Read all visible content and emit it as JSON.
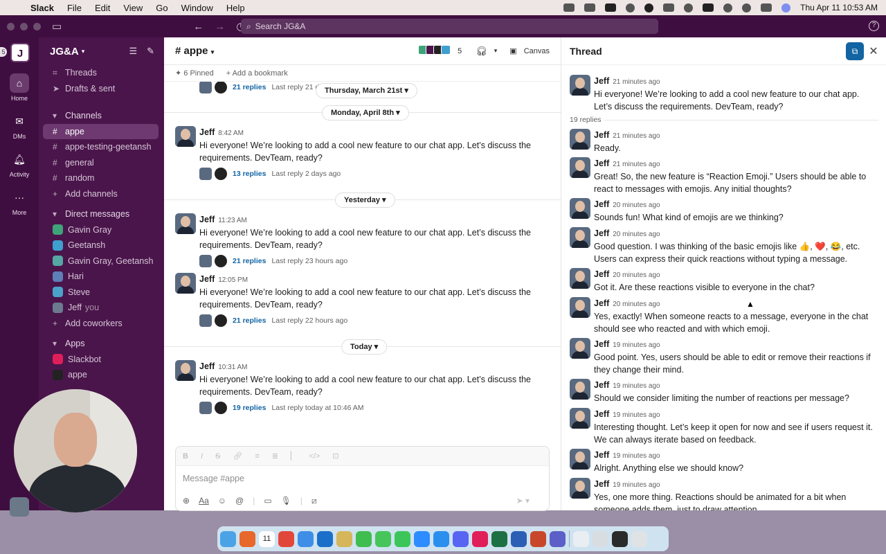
{
  "menubar": {
    "app": "Slack",
    "items": [
      "File",
      "Edit",
      "View",
      "Go",
      "Window",
      "Help"
    ],
    "datetime": "Thu Apr 11  10:53 AM"
  },
  "topbar": {
    "search_placeholder": "Search JG&A"
  },
  "rail": {
    "workspace_initial": "J",
    "badge": "5",
    "items": [
      {
        "label": "Home",
        "icon": "home-icon"
      },
      {
        "label": "DMs",
        "icon": "dm-icon"
      },
      {
        "label": "Activity",
        "icon": "bell-icon"
      },
      {
        "label": "More",
        "icon": "more-icon"
      }
    ]
  },
  "sidebar": {
    "workspace": "JG&A",
    "threads": "Threads",
    "drafts": "Drafts & sent",
    "channels_header": "Channels",
    "channels": [
      "appe",
      "appe-testing-geetansh",
      "general",
      "random"
    ],
    "add_channels": "Add channels",
    "dm_header": "Direct messages",
    "dms": [
      {
        "name": "Gavin Gray",
        "color": "#3fa37a"
      },
      {
        "name": "Geetansh",
        "color": "#3f9fcf"
      },
      {
        "name": "Gavin Gray, Geetansh",
        "color": "#56a6a3"
      },
      {
        "name": "Hari",
        "color": "#5e7fb8"
      },
      {
        "name": "Steve",
        "color": "#4aa3c8"
      },
      {
        "name": "Jeff",
        "color": "#6b7a8f"
      }
    ],
    "you": "you",
    "add_coworkers": "Add coworkers",
    "apps_header": "Apps",
    "apps": [
      "Slackbot",
      "appe"
    ]
  },
  "channel": {
    "name": "appe",
    "member_count": "5",
    "canvas": "Canvas",
    "pinned": "6 Pinned",
    "bookmark": "Add a bookmark",
    "dates": [
      "Thursday, March 21st",
      "Monday, April 8th",
      "Yesterday",
      "Today"
    ],
    "top_partial": {
      "replies": "21 replies",
      "last": "Last reply 21 da"
    },
    "messages": [
      {
        "name": "Jeff",
        "time": "8:42 AM",
        "text": "Hi everyone!  We’re looking to add a cool new feature to our chat app. Let’s discuss the requirements. DevTeam, ready?",
        "replies": "13 replies",
        "last": "Last reply 2 days ago"
      },
      {
        "name": "Jeff",
        "time": "11:23 AM",
        "text": "Hi everyone!  We’re looking to add a cool new feature to our chat app. Let’s discuss the requirements. DevTeam, ready?",
        "replies": "21 replies",
        "last": "Last reply 23 hours ago"
      },
      {
        "name": "Jeff",
        "time": "12:05 PM",
        "text": "Hi everyone!  We’re looking to add a cool new feature to our chat app. Let’s discuss the requirements. DevTeam, ready?",
        "replies": "21 replies",
        "last": "Last reply 22 hours ago"
      },
      {
        "name": "Jeff",
        "time": "10:31 AM",
        "text": "Hi everyone! We’re looking to add a cool new feature to our chat app. Let’s discuss the requirements. DevTeam, ready?",
        "replies": "19 replies",
        "last": "Last reply today at 10:46 AM"
      }
    ],
    "composer_placeholder": "Message #appe"
  },
  "thread": {
    "title": "Thread",
    "reply_count": "19 replies",
    "parent": {
      "name": "Jeff",
      "time": "21 minutes ago",
      "text": "Hi everyone! We’re looking to add a cool new feature to our chat app. Let’s discuss the requirements. DevTeam, ready?"
    },
    "replies": [
      {
        "name": "Jeff",
        "time": "21 minutes ago",
        "text": "Ready."
      },
      {
        "name": "Jeff",
        "time": "21 minutes ago",
        "text": "Great! So, the new feature is “Reaction Emoji.” Users should be able to react to messages with emojis. Any initial thoughts?"
      },
      {
        "name": "Jeff",
        "time": "20 minutes ago",
        "text": "Sounds fun! What kind of emojis are we thinking?"
      },
      {
        "name": "Jeff",
        "time": "20 minutes ago",
        "text": "Good question. I was thinking of the basic emojis like 👍, ❤️, 😂, etc. Users can express their quick reactions without typing a message."
      },
      {
        "name": "Jeff",
        "time": "20 minutes ago",
        "text": "Got it. Are these reactions visible to everyone in the chat?"
      },
      {
        "name": "Jeff",
        "time": "20 minutes ago",
        "text": "Yes, exactly! When someone reacts to a message, everyone in the chat should see who reacted and with which emoji."
      },
      {
        "name": "Jeff",
        "time": "19 minutes ago",
        "text": "Good point. Yes, users should be able to edit or remove their reactions if they change their mind."
      },
      {
        "name": "Jeff",
        "time": "19 minutes ago",
        "text": "Should we consider limiting the number of reactions per message?"
      },
      {
        "name": "Jeff",
        "time": "19 minutes ago",
        "text": "Interesting thought. Let’s keep it open for now and see if users request it. We can always iterate based on feedback."
      },
      {
        "name": "Jeff",
        "time": "19 minutes ago",
        "text": "Alright. Anything else we should know?"
      },
      {
        "name": "Jeff",
        "time": "19 minutes ago",
        "text": "Yes, one more thing. Reactions should be animated for a bit when someone adds them, just to draw attention."
      }
    ]
  },
  "dock": {
    "apps": [
      "finder-icon",
      "firefox-icon",
      "calendar-icon",
      "chrome-icon",
      "mail-icon",
      "outlook-icon",
      "notes-icon",
      "whatsapp-icon",
      "messages-icon",
      "facetime-icon",
      "zoom-icon",
      "appstore-icon",
      "discord-icon",
      "slack-icon",
      "excel-icon",
      "word-icon",
      "powerpoint-icon",
      "teams-icon",
      "preview-icon",
      "screenshot-icon",
      "terminal-icon",
      "trash-icon"
    ],
    "colors": [
      "#4ba3e6",
      "#e8672a",
      "#fdfdfd",
      "#e2463b",
      "#3e8ee8",
      "#1a6fc9",
      "#d6b65a",
      "#3fbd4f",
      "#45c55a",
      "#3cc65a",
      "#2d8cff",
      "#2b8fee",
      "#5865f2",
      "#e01e5a",
      "#1d7044",
      "#2b5eb5",
      "#c8472b",
      "#5b5fc7",
      "#e9eef3",
      "#d8dde2",
      "#2a2a2a",
      "#dfe3e6"
    ],
    "calendar_day": "11"
  }
}
